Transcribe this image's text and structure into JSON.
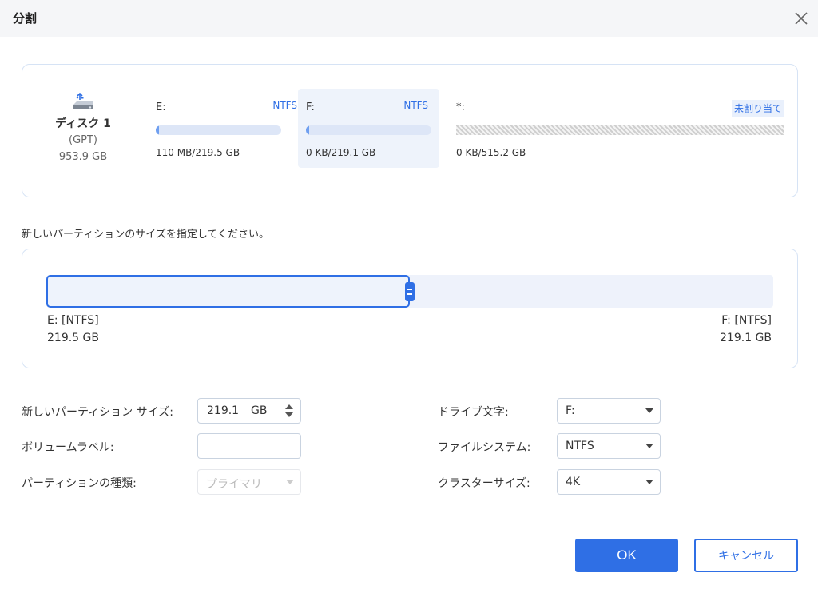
{
  "dialog": {
    "title": "分割",
    "close_icon": "close-icon"
  },
  "disk": {
    "icon": "usb-disk-icon",
    "name": "ディスク 1",
    "style": "(GPT)",
    "capacity": "953.9 GB"
  },
  "partitions": [
    {
      "letter": "E:",
      "fs": "NTFS",
      "size": "110 MB/219.5 GB",
      "used_fraction": 0.0005,
      "selected": false
    },
    {
      "letter": "F:",
      "fs": "NTFS",
      "size": "0 KB/219.1 GB",
      "used_fraction": 0.0,
      "selected": true
    },
    {
      "letter": "*:",
      "fs": "未割り当て",
      "size": "0 KB/515.2 GB",
      "used_fraction": 0.0,
      "selected": false
    }
  ],
  "resize": {
    "prompt": "新しいパーティションのサイズを指定してください。",
    "left": {
      "name": "E: [NTFS]",
      "size": "219.5 GB"
    },
    "right": {
      "name": "F: [NTFS]",
      "size": "219.1 GB"
    },
    "split_fraction": 0.5
  },
  "form": {
    "size_label": "新しいパーティション サイズ:",
    "size_value": "219.1",
    "size_unit": "GB",
    "volume_label": "ボリュームラベル:",
    "volume_value": "",
    "type_label": "パーティションの種類:",
    "type_value": "プライマリ",
    "drive_label": "ドライブ文字:",
    "drive_value": "F:",
    "fs_label": "ファイルシステム:",
    "fs_value": "NTFS",
    "cluster_label": "クラスターサイズ:",
    "cluster_value": "4K"
  },
  "buttons": {
    "ok": "OK",
    "cancel": "キャンセル"
  },
  "colors": {
    "accent": "#2f6fe5",
    "bar_bg": "#dde6f7",
    "bar_fill": "#6f9ff0"
  }
}
